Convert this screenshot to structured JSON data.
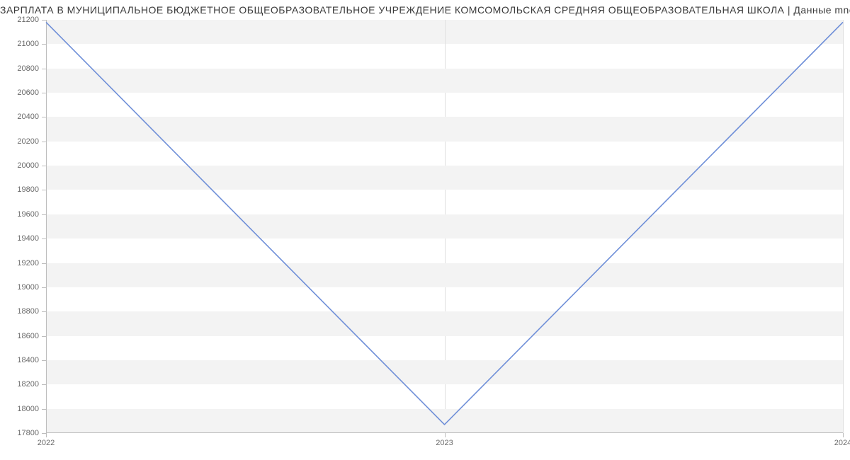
{
  "chart_data": {
    "type": "line",
    "title": "ЗАРПЛАТА В МУНИЦИПАЛЬНОЕ БЮДЖЕТНОЕ ОБЩЕОБРАЗОВАТЕЛЬНОЕ УЧРЕЖДЕНИЕ КОМСОМОЛЬСКАЯ СРЕДНЯЯ ОБЩЕОБРАЗОВАТЕЛЬНАЯ ШКОЛА | Данные mnogo.work",
    "x": [
      "2022",
      "2023",
      "2024"
    ],
    "values": [
      21180,
      17870,
      21180
    ],
    "xlabel": "",
    "ylabel": "",
    "ylim": [
      17800,
      21200
    ],
    "y_ticks": [
      17800,
      18000,
      18200,
      18400,
      18600,
      18800,
      19000,
      19200,
      19400,
      19600,
      19800,
      20000,
      20200,
      20400,
      20600,
      20800,
      21000,
      21200
    ],
    "line_color": "#6f8fd8"
  }
}
